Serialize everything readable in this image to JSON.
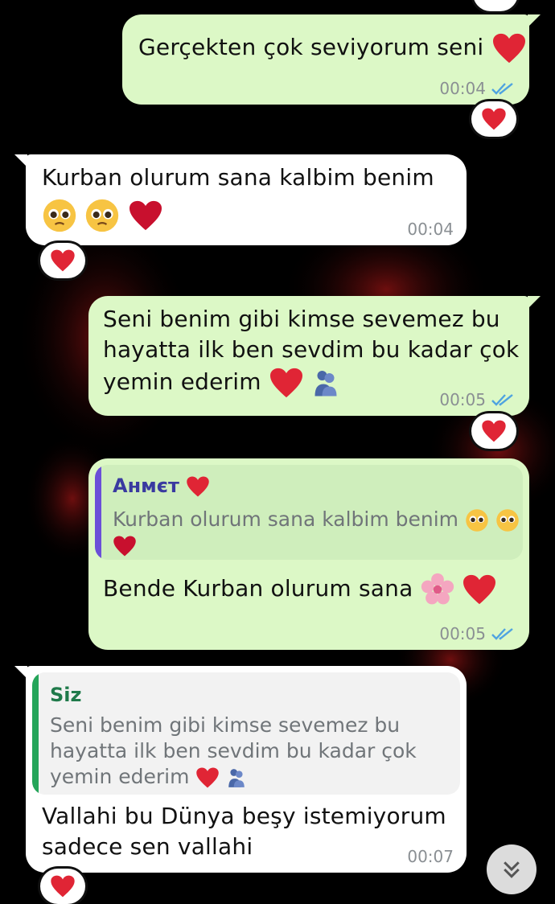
{
  "colors": {
    "outgoing_bubble": "#dcf8c6",
    "incoming_bubble": "#ffffff",
    "read_ticks": "#4fa3e0",
    "quote_author_out": "#3a3aa0",
    "quote_bar_out": "#6b4fd8",
    "quote_author_in": "#1f7a4a",
    "quote_bar_in": "#25a55a",
    "heart": "#e02535"
  },
  "messages": [
    {
      "text_lines": [
        "Gerçekten çok seviyorum seni"
      ],
      "emojis": [
        "heart-emoji"
      ],
      "time": "00:04",
      "status": "read",
      "reaction": "heart-emoji"
    },
    {
      "text_lines": [
        "Kurban olurum sana kalbim benim"
      ],
      "emojis": [
        "pleading-face-emoji",
        "pleading-face-emoji",
        "heart-emoji"
      ],
      "time": "00:04",
      "reaction": "heart-emoji"
    },
    {
      "text_lines": [
        "Seni benim gibi kimse sevemez bu",
        "hayatta ilk ben sevdim bu kadar çok",
        "yemin ederim"
      ],
      "emojis": [
        "heart-emoji",
        "people-hugging-emoji"
      ],
      "time": "00:05",
      "status": "read",
      "reaction": "heart-emoji"
    },
    {
      "quote_author": "Aнмєт",
      "quote_lines": [
        "Kurban olurum sana kalbim benim"
      ],
      "text": "Bende Kurban olurum sana",
      "time": "00:05",
      "status": "read"
    },
    {
      "quote_author": "Siz",
      "quote_lines": [
        "Seni benim gibi kimse sevemez bu",
        "hayatta ilk ben sevdim bu kadar çok",
        "yemin ederim"
      ],
      "text_lines": [
        "Vallahi bu Dünya beşy istemiyorum",
        "sadece sen vallahi"
      ],
      "time": "00:07",
      "reaction": "heart-emoji"
    }
  ],
  "scroll_button": {
    "icon": "double-chevron-down-icon"
  }
}
